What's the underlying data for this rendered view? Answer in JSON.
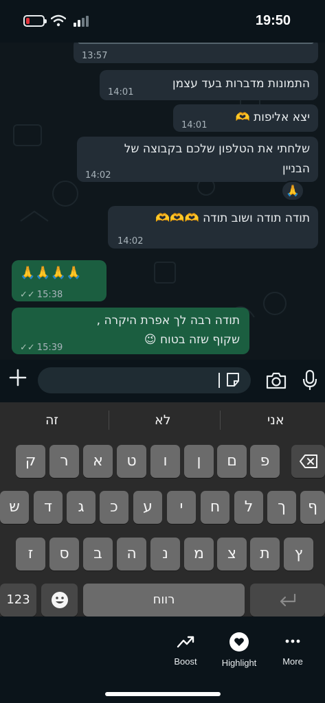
{
  "status_bar": {
    "time": "19:50"
  },
  "messages": [
    {
      "id": "m0",
      "direction": "in",
      "text": "",
      "time": "13:57"
    },
    {
      "id": "m1",
      "direction": "in",
      "text": "התמונות מדברות בעד עצמן",
      "time": "14:01"
    },
    {
      "id": "m2",
      "direction": "in",
      "text": "יצא אליפות 🫶",
      "time": "14:01"
    },
    {
      "id": "m3",
      "direction": "in",
      "line1": "שלחתי את הטלפון שלכם בקבוצה של",
      "line2": "הבניין",
      "time": "14:02",
      "reaction": "🙏"
    },
    {
      "id": "m4",
      "direction": "in",
      "text": "תודה תודה ושוב תודה 🫶🫶🫶",
      "time": "14:02"
    },
    {
      "id": "m5",
      "direction": "out",
      "text": "🙏🙏🙏🙏",
      "time": "15:38",
      "ticks": "✓✓"
    },
    {
      "id": "m6",
      "direction": "out",
      "line1": "תודה רבה לך אפרת היקרה ,",
      "line2": "שקוף שזה בטוח 😉",
      "time": "15:39",
      "ticks": "✓✓"
    }
  ],
  "keyboard": {
    "suggestions": [
      "אני",
      "לא",
      "זה"
    ],
    "row1": [
      "פ",
      "ם",
      "ן",
      "ו",
      "ט",
      "א",
      "ר",
      "ק"
    ],
    "row2": [
      "ף",
      "ך",
      "ל",
      "ח",
      "י",
      "ע",
      "כ",
      "ג",
      "ד",
      "ש"
    ],
    "row3": [
      "ץ",
      "ת",
      "צ",
      "מ",
      "נ",
      "ה",
      "ב",
      "ס",
      "ז"
    ],
    "numbers_label": "123",
    "space_label": "רווח"
  },
  "actions": {
    "boost": "Boost",
    "highlight": "Highlight",
    "more": "More"
  },
  "colors": {
    "incoming_bubble": "#232d36",
    "outgoing_bubble": "#1b5e40",
    "background": "#0b141a"
  }
}
